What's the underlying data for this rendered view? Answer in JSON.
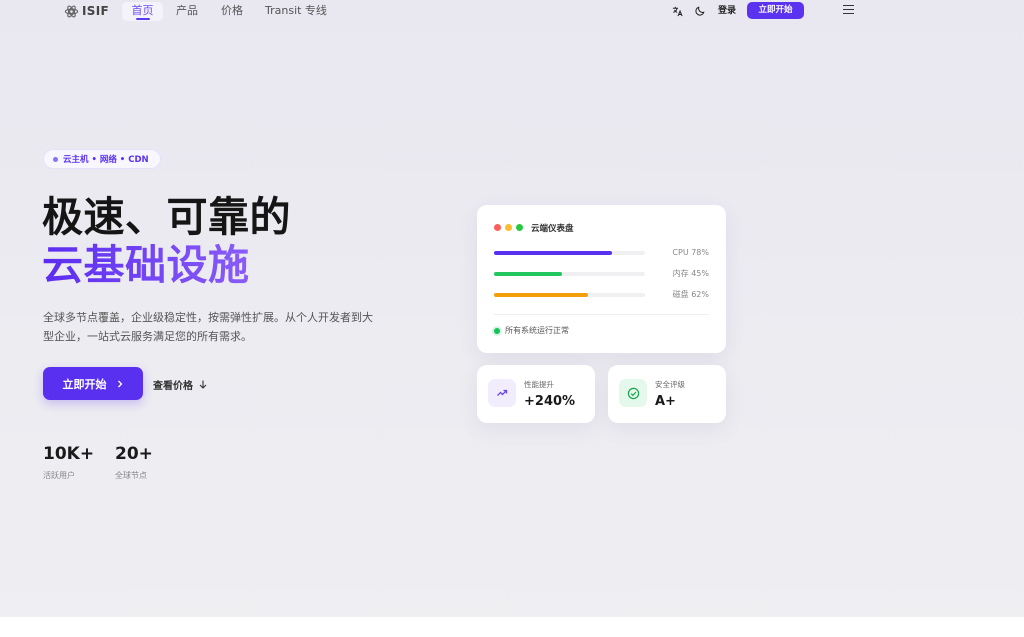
{
  "nav": {
    "logo_text": "ISIF",
    "links": [
      {
        "label": "首页",
        "active": true
      },
      {
        "label": "产品"
      },
      {
        "label": "价格"
      },
      {
        "label": "Transit 专线"
      }
    ],
    "translate_icon": "translate-icon",
    "theme_icon": "moon-icon",
    "login_label": "登录",
    "cta_label": "立即开始",
    "menu_icon": "hamburger-menu-icon"
  },
  "hero": {
    "pill_text": "云主机 • 网络 • CDN",
    "title_line1": "极速、可靠的",
    "title_line2": "云基础设施",
    "description": "全球多节点覆盖，企业级稳定性，按需弹性扩展。从个人开发者到大型企业，一站式云服务满足您的所有需求。",
    "primary_button": "立即开始",
    "secondary_button": "查看价格",
    "stats": [
      {
        "value": "10K+",
        "label": "活跃用户"
      },
      {
        "value": "20+",
        "label": "全球节点"
      }
    ]
  },
  "dashboard": {
    "title": "云端仪表盘",
    "window_dot_colors": [
      "#ff5f57",
      "#febc2e",
      "#28c840"
    ],
    "bars": [
      {
        "label": "CPU 78%",
        "value": 78,
        "color": "#5a30f0"
      },
      {
        "label": "内存 45%",
        "value": 45,
        "color": "#22c55e"
      },
      {
        "label": "磁盘 62%",
        "value": 62,
        "color": "#f59e0b"
      }
    ],
    "status_text": "所有系统运行正常"
  },
  "cards": [
    {
      "label": "性能提升",
      "value": "+240%",
      "icon": "trending-up-icon",
      "icon_bg": "#f1edfd",
      "icon_color": "#6a45f2"
    },
    {
      "label": "安全评级",
      "value": "A+",
      "icon": "check-circle-icon",
      "icon_bg": "#e5f8ec",
      "icon_color": "#16a34a"
    }
  ]
}
